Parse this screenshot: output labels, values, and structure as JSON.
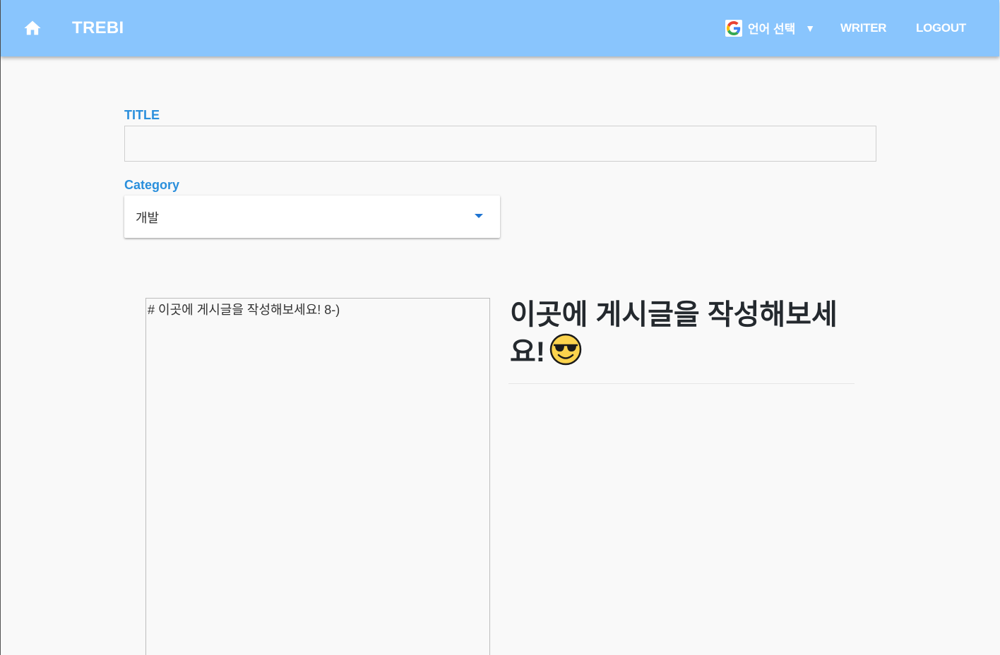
{
  "header": {
    "brand": "TREBI",
    "language_selector": "언어 선택",
    "nav": {
      "writer": "WRITER",
      "logout": "LOGOUT"
    },
    "icons": {
      "home": "home-icon",
      "google": "google-g-icon",
      "caret": "caret-down-icon"
    },
    "colors": {
      "appbar": "#89c5fd",
      "accent_label": "#2a8fdc"
    }
  },
  "form": {
    "title_label": "TITLE",
    "title_value": "",
    "category_label": "Category",
    "category_value": "개발"
  },
  "editor": {
    "content": "# 이곳에 게시글을 작성해보세요! 8-)"
  },
  "preview": {
    "heading": "이곳에 게시글을 작성해보세요!",
    "emoji": "sunglasses-emoji"
  }
}
